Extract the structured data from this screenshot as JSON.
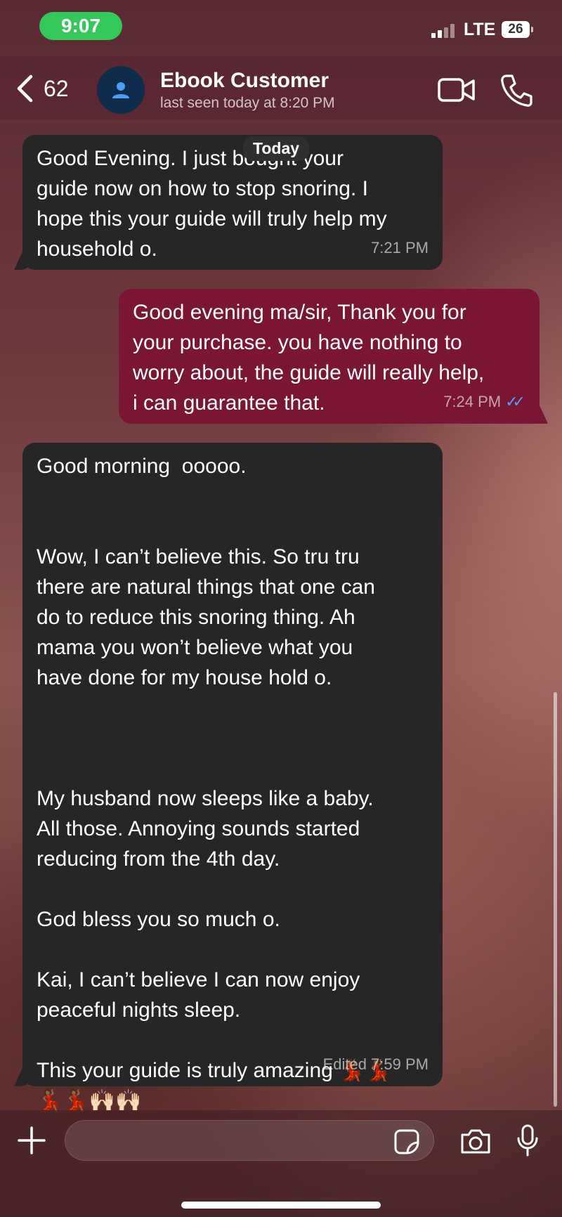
{
  "status_bar": {
    "time": "9:07",
    "network": "LTE",
    "battery": "26"
  },
  "header": {
    "back_count": "62",
    "contact_name": "Ebook Customer",
    "contact_status": "last seen today at 8:20 PM"
  },
  "date_chip": "Today",
  "messages": [
    {
      "direction": "incoming",
      "text": "Good Evening. I just bought your\nguide now on how to stop snoring. I\nhope this your guide will truly help my\nhousehold o.",
      "time": "7:21 PM"
    },
    {
      "direction": "outgoing",
      "text": "Good evening ma/sir, Thank you for\nyour purchase. you have nothing to\nworry about, the guide will really help,\ni can guarantee that.",
      "time": "7:24 PM",
      "read_receipt": "read"
    },
    {
      "direction": "incoming",
      "text": "Good morning  ooooo.\n\n\nWow, I can’t believe this. So tru tru\nthere are natural things that one can\ndo to reduce this snoring thing. Ah\nmama you won’t believe what you\nhave done for my house hold o.\n\n\n\nMy husband now sleeps like a baby.\nAll those. Annoying sounds started\nreducing from the 4th day.\n\nGod bless you so much o.\n\nKai, I can’t believe I can now enjoy\npeaceful nights sleep.\n\nThis your guide is truly amazing 💃🏾💃🏾\n💃🏾💃🏾🙌🏻🙌🏻",
      "time": "Edited 7:59 PM"
    }
  ],
  "composer": {
    "placeholder": ""
  },
  "colors": {
    "incoming_bubble": "#262626",
    "outgoing_bubble": "#7a1634",
    "read_check": "#4fa3ff",
    "time_pill": "#34c759"
  },
  "icons": [
    "back-chevron-icon",
    "contact-avatar-icon",
    "video-call-icon",
    "phone-icon",
    "plus-icon",
    "sticker-icon",
    "camera-icon",
    "microphone-icon",
    "double-check-icon"
  ]
}
